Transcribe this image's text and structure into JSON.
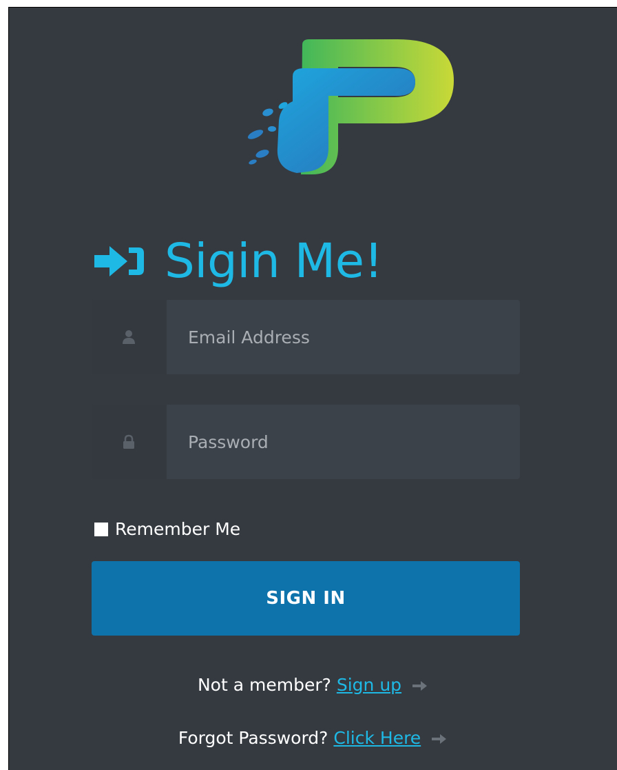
{
  "heading": {
    "title": "Sigin Me!",
    "icon": "sign-in-icon"
  },
  "email": {
    "placeholder": "Email Address",
    "icon": "user-icon"
  },
  "password": {
    "placeholder": "Password",
    "icon": "lock-icon"
  },
  "remember": {
    "label": "Remember Me",
    "checked": false
  },
  "signin_button": {
    "label": "SIGN IN"
  },
  "signup_line": {
    "text": "Not a member?",
    "link": "Sign up",
    "icon": "arrow-right-icon"
  },
  "forgot_line": {
    "text": "Forgot Password?",
    "link": "Click Here",
    "icon": "arrow-right-icon"
  },
  "colors": {
    "background": "#353a41",
    "accent": "#1fb9e6",
    "button": "#0f73ab",
    "input": "#3c4249"
  }
}
